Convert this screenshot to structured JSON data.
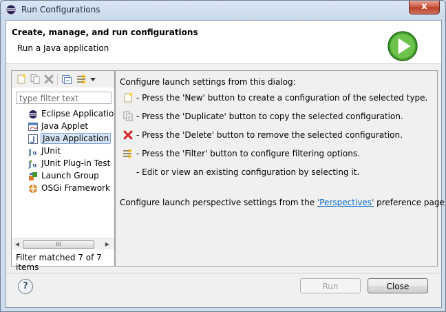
{
  "window": {
    "title": "Run Configurations",
    "close_label": "x"
  },
  "banner": {
    "title": "Create, manage, and run configurations",
    "subtitle": "Run a Java application",
    "icon": "run-play-icon"
  },
  "toolbar": {
    "buttons": [
      "new-config-icon",
      "duplicate-icon",
      "delete-icon",
      "collapse-all-icon",
      "filter-icon",
      "view-menu-icon"
    ]
  },
  "filter": {
    "placeholder": "type filter text"
  },
  "tree": {
    "items": [
      {
        "label": "Eclipse Application",
        "icon": "eclipse-icon"
      },
      {
        "label": "Java Applet",
        "icon": "applet-icon"
      },
      {
        "label": "Java Application",
        "icon": "java-app-icon",
        "selected": true
      },
      {
        "label": "JUnit",
        "icon": "junit-icon"
      },
      {
        "label": "JUnit Plug-in Test",
        "icon": "junit-plugin-icon"
      },
      {
        "label": "Launch Group",
        "icon": "launch-group-icon"
      },
      {
        "label": "OSGi Framework",
        "icon": "osgi-icon"
      }
    ],
    "scroll_thumb_label": "III"
  },
  "filter_status": "Filter matched 7 of 7 items",
  "help": {
    "intro": "Configure launch settings from this dialog:",
    "lines": [
      {
        "icon": "new-config-icon",
        "text": "- Press the 'New' button to create a configuration of the selected type."
      },
      {
        "icon": "duplicate-icon",
        "text": "- Press the 'Duplicate' button to copy the selected configuration."
      },
      {
        "icon": "delete-icon",
        "text": "- Press the 'Delete' button to remove the selected configuration."
      },
      {
        "icon": "filter-icon",
        "text": "- Press the 'Filter' button to configure filtering options."
      },
      {
        "icon": "",
        "text": "- Edit or view an existing configuration by selecting it."
      }
    ],
    "perspectives_prefix": "Configure launch perspective settings from the ",
    "perspectives_link": "'Perspectives'",
    "perspectives_suffix": " preference page."
  },
  "buttons": {
    "help": "?",
    "run": "Run",
    "close": "Close"
  }
}
